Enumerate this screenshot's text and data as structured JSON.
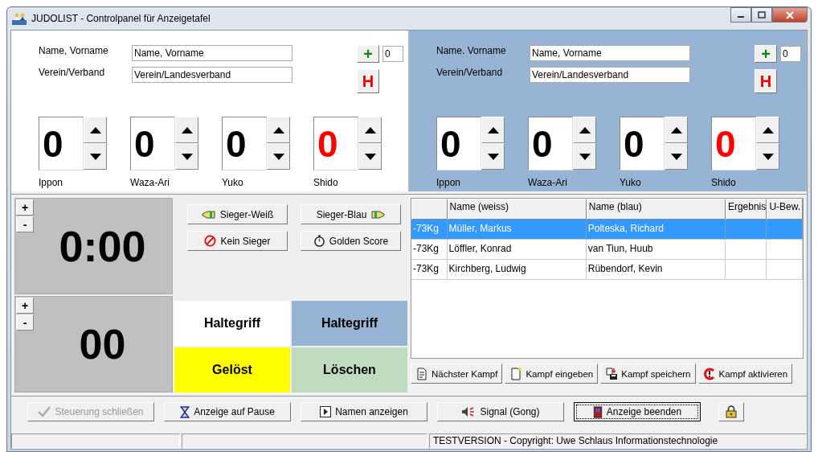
{
  "window": {
    "title": "JUDOLIST - Controlpanel für Anzeigetafel"
  },
  "fighters": [
    {
      "color": "#ffffff",
      "name_label": "Name, Vorname",
      "name_value": "Name, Vorname",
      "club_label": "Verein/Verband",
      "club_value": "Verein/Landesverband",
      "plus": "+",
      "counter": "0",
      "hansoku": "H",
      "scores": [
        {
          "kind": "score",
          "label": "Ippon",
          "value": "0"
        },
        {
          "kind": "score",
          "label": "Waza-Ari",
          "value": "0"
        },
        {
          "kind": "score",
          "label": "Yuko",
          "value": "0"
        },
        {
          "kind": "penalty",
          "label": "Shido",
          "value": "0"
        }
      ]
    },
    {
      "color": "#98b4d4",
      "name_label": "Name. Vorname",
      "name_value": "Name, Vorname",
      "club_label": "Verein/Verband",
      "club_value": "Verein/Landesverband",
      "plus": "+",
      "counter": "0",
      "hansoku": "H",
      "scores": [
        {
          "kind": "score",
          "label": "Ippon",
          "value": "0"
        },
        {
          "kind": "score",
          "label": "Waza-Ari",
          "value": "0"
        },
        {
          "kind": "score",
          "label": "Yuko",
          "value": "0"
        },
        {
          "kind": "penalty",
          "label": "Shido",
          "value": "0"
        }
      ]
    }
  ],
  "clocks": [
    {
      "kind": "fight",
      "plus": "+",
      "minus": "-",
      "value": "0:00"
    },
    {
      "kind": "hold",
      "plus": "+",
      "minus": "-",
      "value": "00"
    }
  ],
  "decision_buttons": [
    "Sieger-Weiß",
    "Sieger-Blau",
    "Kein Sieger",
    "Golden Score"
  ],
  "hold_buttons": [
    {
      "label": "Haltegriff",
      "color": "#ffffff"
    },
    {
      "label": "Haltegriff",
      "color": "#98b4d4"
    },
    {
      "label": "Gelöst",
      "color": "#ffff00"
    },
    {
      "label": "Löschen",
      "color": "#c0dcc0"
    }
  ],
  "table": {
    "columns": [
      "Name (weiss)",
      "Name (blau)",
      "Ergebnis",
      "U-Bew."
    ],
    "rows": [
      {
        "weight": "-73Kg",
        "white": "Müller, Markus",
        "blue": "Polteska, Richard",
        "selected": true
      },
      {
        "weight": "-73Kg",
        "white": "Löffler, Konrad",
        "blue": "van Tiun, Huub",
        "selected": false
      },
      {
        "weight": "-73Kg",
        "white": "Kirchberg, Ludwig",
        "blue": "Rübendorf, Kevin",
        "selected": false
      }
    ]
  },
  "fight_buttons": [
    "Nächster Kampf",
    "Kampf eingeben",
    "Kampf speichern",
    "Kampf aktivieren"
  ],
  "toolbar": [
    {
      "label": "Steuerung schließen",
      "disabled": true
    },
    {
      "label": "Anzeige auf Pause",
      "disabled": false
    },
    {
      "label": "Namen anzeigen",
      "disabled": false
    },
    {
      "label": "Signal (Gong)",
      "disabled": false
    },
    {
      "label": "Anzeige beenden",
      "disabled": false
    }
  ],
  "status_bar": "TESTVERSION - Copyright: Uwe Schlaus Informationstechnologie"
}
